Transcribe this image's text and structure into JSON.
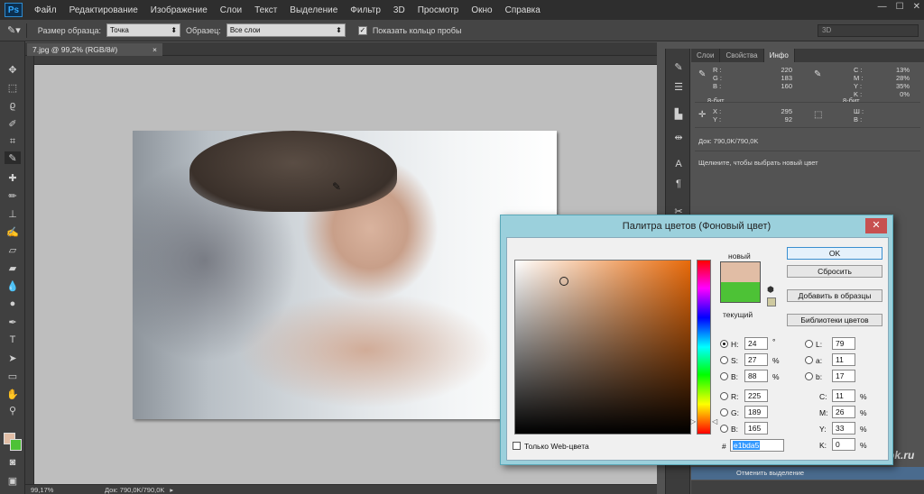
{
  "app": {
    "logo": "Ps"
  },
  "menu": [
    "Файл",
    "Редактирование",
    "Изображение",
    "Слои",
    "Текст",
    "Выделение",
    "Фильтр",
    "3D",
    "Просмотр",
    "Окно",
    "Справка"
  ],
  "window_buttons": [
    "—",
    "☐",
    "✕"
  ],
  "options": {
    "sample_size_label": "Размер образца:",
    "sample_size_value": "Точка",
    "sample_label": "Образец:",
    "sample_value": "Все слои",
    "show_ring_label": "Показать кольцо пробы",
    "show_ring_checked": "✓",
    "workspace": "3D"
  },
  "document": {
    "tab_title": "7.jpg @ 99,2% (RGB/8#)",
    "tab_close": "×",
    "zoom": "99,17%",
    "doc_size": "Док: 790,0K/790,0K"
  },
  "panels": {
    "tabs": [
      "Слои",
      "Свойства",
      "Инфо"
    ],
    "info": {
      "rgb_labels": [
        "R :",
        "G :",
        "B :"
      ],
      "rgb_values": [
        "220",
        "183",
        "160"
      ],
      "cmyk_labels": [
        "C :",
        "M :",
        "Y :",
        "K :"
      ],
      "cmyk_values": [
        "13%",
        "28%",
        "35%",
        "0%"
      ],
      "bits_left": "8-бит",
      "bits_right": "8-бит",
      "xy_labels": [
        "X :",
        "Y :"
      ],
      "xy_values": [
        "295",
        "92"
      ],
      "wh_labels": [
        "Ш :",
        "В :"
      ],
      "doc_size": "Док: 790,0K/790,0K",
      "hint": "Щелкните, чтобы выбрать новый цвет"
    },
    "history_item": "Отменить выделение"
  },
  "dialog": {
    "title": "Палитра цветов (Фоновый цвет)",
    "close": "✕",
    "new_label": "новый",
    "current_label": "текущий",
    "buttons": {
      "ok": "OK",
      "reset": "Сбросить",
      "add_swatch": "Добавить в образцы",
      "libraries": "Библиотеки цветов"
    },
    "fields": {
      "H": {
        "label": "H:",
        "value": "24",
        "unit": "°"
      },
      "S": {
        "label": "S:",
        "value": "27",
        "unit": "%"
      },
      "B": {
        "label": "B:",
        "value": "88",
        "unit": "%"
      },
      "R": {
        "label": "R:",
        "value": "225"
      },
      "G": {
        "label": "G:",
        "value": "189"
      },
      "Bl": {
        "label": "B:",
        "value": "165"
      },
      "L": {
        "label": "L:",
        "value": "79"
      },
      "a": {
        "label": "a:",
        "value": "11"
      },
      "b": {
        "label": "b:",
        "value": "17"
      },
      "C": {
        "label": "C:",
        "value": "11",
        "unit": "%"
      },
      "M": {
        "label": "M:",
        "value": "26",
        "unit": "%"
      },
      "Y": {
        "label": "Y:",
        "value": "33",
        "unit": "%"
      },
      "K": {
        "label": "K:",
        "value": "0",
        "unit": "%"
      }
    },
    "hex_label": "#",
    "hex_value": "e1bda5",
    "web_only_label": "Только Web-цвета",
    "new_color": "#e1bda5",
    "current_color": "#4dc236"
  },
  "watermark": "Foto komok.ru"
}
